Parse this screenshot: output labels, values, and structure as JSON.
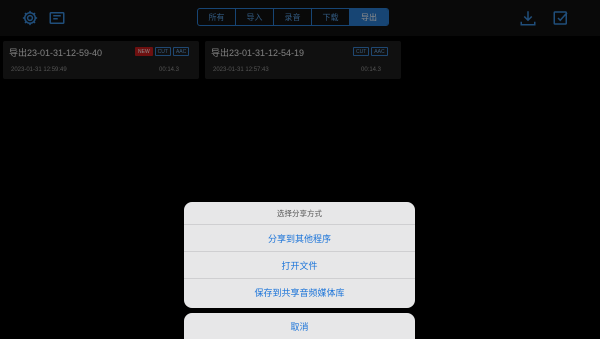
{
  "toolbar": {
    "left_icons": [
      "settings-icon",
      "image-icon"
    ],
    "right_icons": [
      "download-icon",
      "edit-icon"
    ],
    "tabs": [
      {
        "label": "所有",
        "active": false
      },
      {
        "label": "导入",
        "active": false
      },
      {
        "label": "录音",
        "active": false
      },
      {
        "label": "下载",
        "active": false
      },
      {
        "label": "导出",
        "active": true
      }
    ],
    "accent_color": "#2b7fd3"
  },
  "recordings": [
    {
      "name": "导出23-01-31-12-59-40",
      "badges": [
        "NEW",
        "CUT",
        "AAC"
      ],
      "timestamp": "2023-01-31 12:59:49",
      "duration": "00:14.3"
    },
    {
      "name": "导出23-01-31-12-54-19",
      "badges": [
        "CUT",
        "AAC"
      ],
      "timestamp": "2023-01-31 12:57:43",
      "duration": "00:14.3"
    }
  ],
  "share_sheet": {
    "title": "选择分享方式",
    "options": [
      "分享到其他程序",
      "打开文件",
      "保存到共享音频媒体库"
    ],
    "cancel_label": "取消"
  }
}
